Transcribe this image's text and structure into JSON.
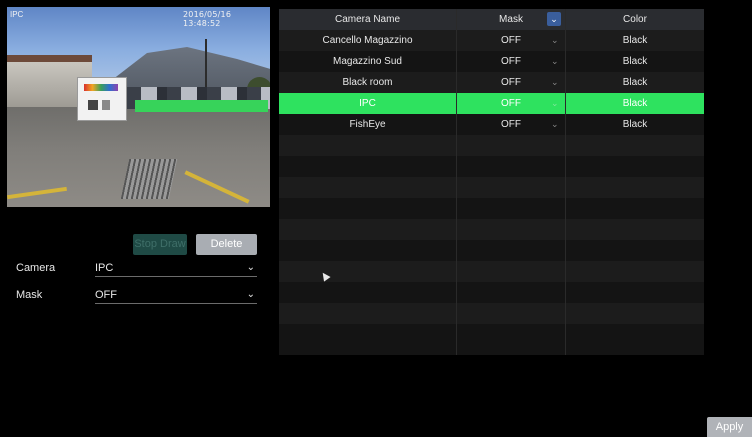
{
  "preview": {
    "channel_label": "IPC",
    "timestamp": "2016/05/16 13:48:52"
  },
  "buttons": {
    "stop_draw": "Stop Draw",
    "delete": "Delete",
    "apply": "Apply"
  },
  "form": {
    "camera_label": "Camera",
    "camera_value": "IPC",
    "mask_label": "Mask",
    "mask_value": "OFF"
  },
  "table": {
    "headers": {
      "camera_name": "Camera Name",
      "mask": "Mask",
      "color": "Color"
    },
    "rows": [
      {
        "camera": "Cancello Magazzino",
        "mask": "OFF",
        "color": "Black"
      },
      {
        "camera": "Magazzino Sud",
        "mask": "OFF",
        "color": "Black"
      },
      {
        "camera": "Black room",
        "mask": "OFF",
        "color": "Black"
      },
      {
        "camera": "IPC",
        "mask": "OFF",
        "color": "Black"
      },
      {
        "camera": "FishEye",
        "mask": "OFF",
        "color": "Black"
      }
    ],
    "selected_row_index": 3
  },
  "colors": {
    "accent_green": "#2ee25f",
    "mask_region": "#37d35a",
    "header_bg": "#2a2c30"
  }
}
